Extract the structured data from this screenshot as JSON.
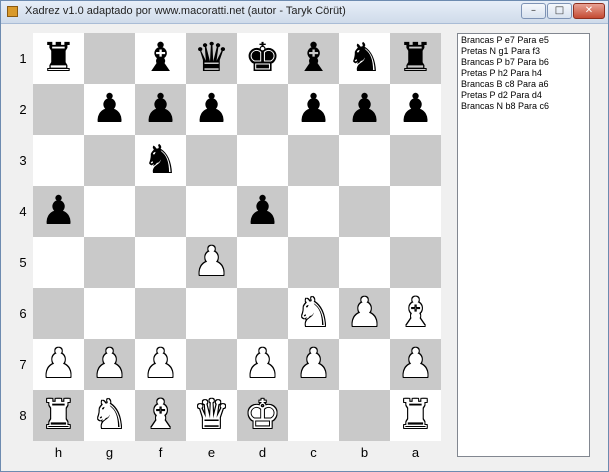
{
  "window": {
    "title": "Xadrez v1.0 adaptado por www.macoratti.net (autor - Taryk Cörüt)",
    "minimize_glyph": "–",
    "maximize_glyph": "□",
    "close_glyph": "✕"
  },
  "board": {
    "rank_labels": [
      "1",
      "2",
      "3",
      "4",
      "5",
      "6",
      "7",
      "8"
    ],
    "file_labels": [
      "h",
      "g",
      "f",
      "e",
      "d",
      "c",
      "b",
      "a"
    ],
    "light_color": "#ffffff",
    "dark_color": "#c9c9c9",
    "pieces": [
      {
        "rank": 1,
        "file": "h",
        "color": "black",
        "type": "rook",
        "glyph": "♜"
      },
      {
        "rank": 1,
        "file": "f",
        "color": "black",
        "type": "bishop",
        "glyph": "♝"
      },
      {
        "rank": 1,
        "file": "e",
        "color": "black",
        "type": "queen",
        "glyph": "♛"
      },
      {
        "rank": 1,
        "file": "d",
        "color": "black",
        "type": "king",
        "glyph": "♚"
      },
      {
        "rank": 1,
        "file": "c",
        "color": "black",
        "type": "bishop",
        "glyph": "♝"
      },
      {
        "rank": 1,
        "file": "b",
        "color": "black",
        "type": "knight",
        "glyph": "♞"
      },
      {
        "rank": 1,
        "file": "a",
        "color": "black",
        "type": "rook",
        "glyph": "♜"
      },
      {
        "rank": 2,
        "file": "g",
        "color": "black",
        "type": "pawn",
        "glyph": "♟"
      },
      {
        "rank": 2,
        "file": "f",
        "color": "black",
        "type": "pawn",
        "glyph": "♟"
      },
      {
        "rank": 2,
        "file": "e",
        "color": "black",
        "type": "pawn",
        "glyph": "♟"
      },
      {
        "rank": 2,
        "file": "c",
        "color": "black",
        "type": "pawn",
        "glyph": "♟"
      },
      {
        "rank": 2,
        "file": "b",
        "color": "black",
        "type": "pawn",
        "glyph": "♟"
      },
      {
        "rank": 2,
        "file": "a",
        "color": "black",
        "type": "pawn",
        "glyph": "♟"
      },
      {
        "rank": 3,
        "file": "f",
        "color": "black",
        "type": "knight",
        "glyph": "♞"
      },
      {
        "rank": 4,
        "file": "h",
        "color": "black",
        "type": "pawn",
        "glyph": "♟"
      },
      {
        "rank": 4,
        "file": "d",
        "color": "black",
        "type": "pawn",
        "glyph": "♟"
      },
      {
        "rank": 5,
        "file": "e",
        "color": "white",
        "type": "pawn",
        "glyph": "♟"
      },
      {
        "rank": 6,
        "file": "c",
        "color": "white",
        "type": "knight",
        "glyph": "♞"
      },
      {
        "rank": 6,
        "file": "b",
        "color": "white",
        "type": "pawn",
        "glyph": "♟"
      },
      {
        "rank": 6,
        "file": "a",
        "color": "white",
        "type": "bishop",
        "glyph": "♝"
      },
      {
        "rank": 7,
        "file": "h",
        "color": "white",
        "type": "pawn",
        "glyph": "♟"
      },
      {
        "rank": 7,
        "file": "g",
        "color": "white",
        "type": "pawn",
        "glyph": "♟"
      },
      {
        "rank": 7,
        "file": "f",
        "color": "white",
        "type": "pawn",
        "glyph": "♟"
      },
      {
        "rank": 7,
        "file": "d",
        "color": "white",
        "type": "pawn",
        "glyph": "♟"
      },
      {
        "rank": 7,
        "file": "c",
        "color": "white",
        "type": "pawn",
        "glyph": "♟"
      },
      {
        "rank": 7,
        "file": "a",
        "color": "white",
        "type": "pawn",
        "glyph": "♟"
      },
      {
        "rank": 8,
        "file": "h",
        "color": "white",
        "type": "rook",
        "glyph": "♜"
      },
      {
        "rank": 8,
        "file": "g",
        "color": "white",
        "type": "knight",
        "glyph": "♞"
      },
      {
        "rank": 8,
        "file": "f",
        "color": "white",
        "type": "bishop",
        "glyph": "♝"
      },
      {
        "rank": 8,
        "file": "e",
        "color": "white",
        "type": "queen",
        "glyph": "♛"
      },
      {
        "rank": 8,
        "file": "d",
        "color": "white",
        "type": "king",
        "glyph": "♚"
      },
      {
        "rank": 8,
        "file": "a",
        "color": "white",
        "type": "rook",
        "glyph": "♜"
      }
    ]
  },
  "moves": [
    "Brancas P e7 Para e5",
    "Pretas N g1 Para f3",
    "Brancas P b7 Para b6",
    "Pretas P h2 Para h4",
    "Brancas B c8 Para a6",
    "Pretas P d2 Para d4",
    "Brancas N b8 Para c6"
  ]
}
